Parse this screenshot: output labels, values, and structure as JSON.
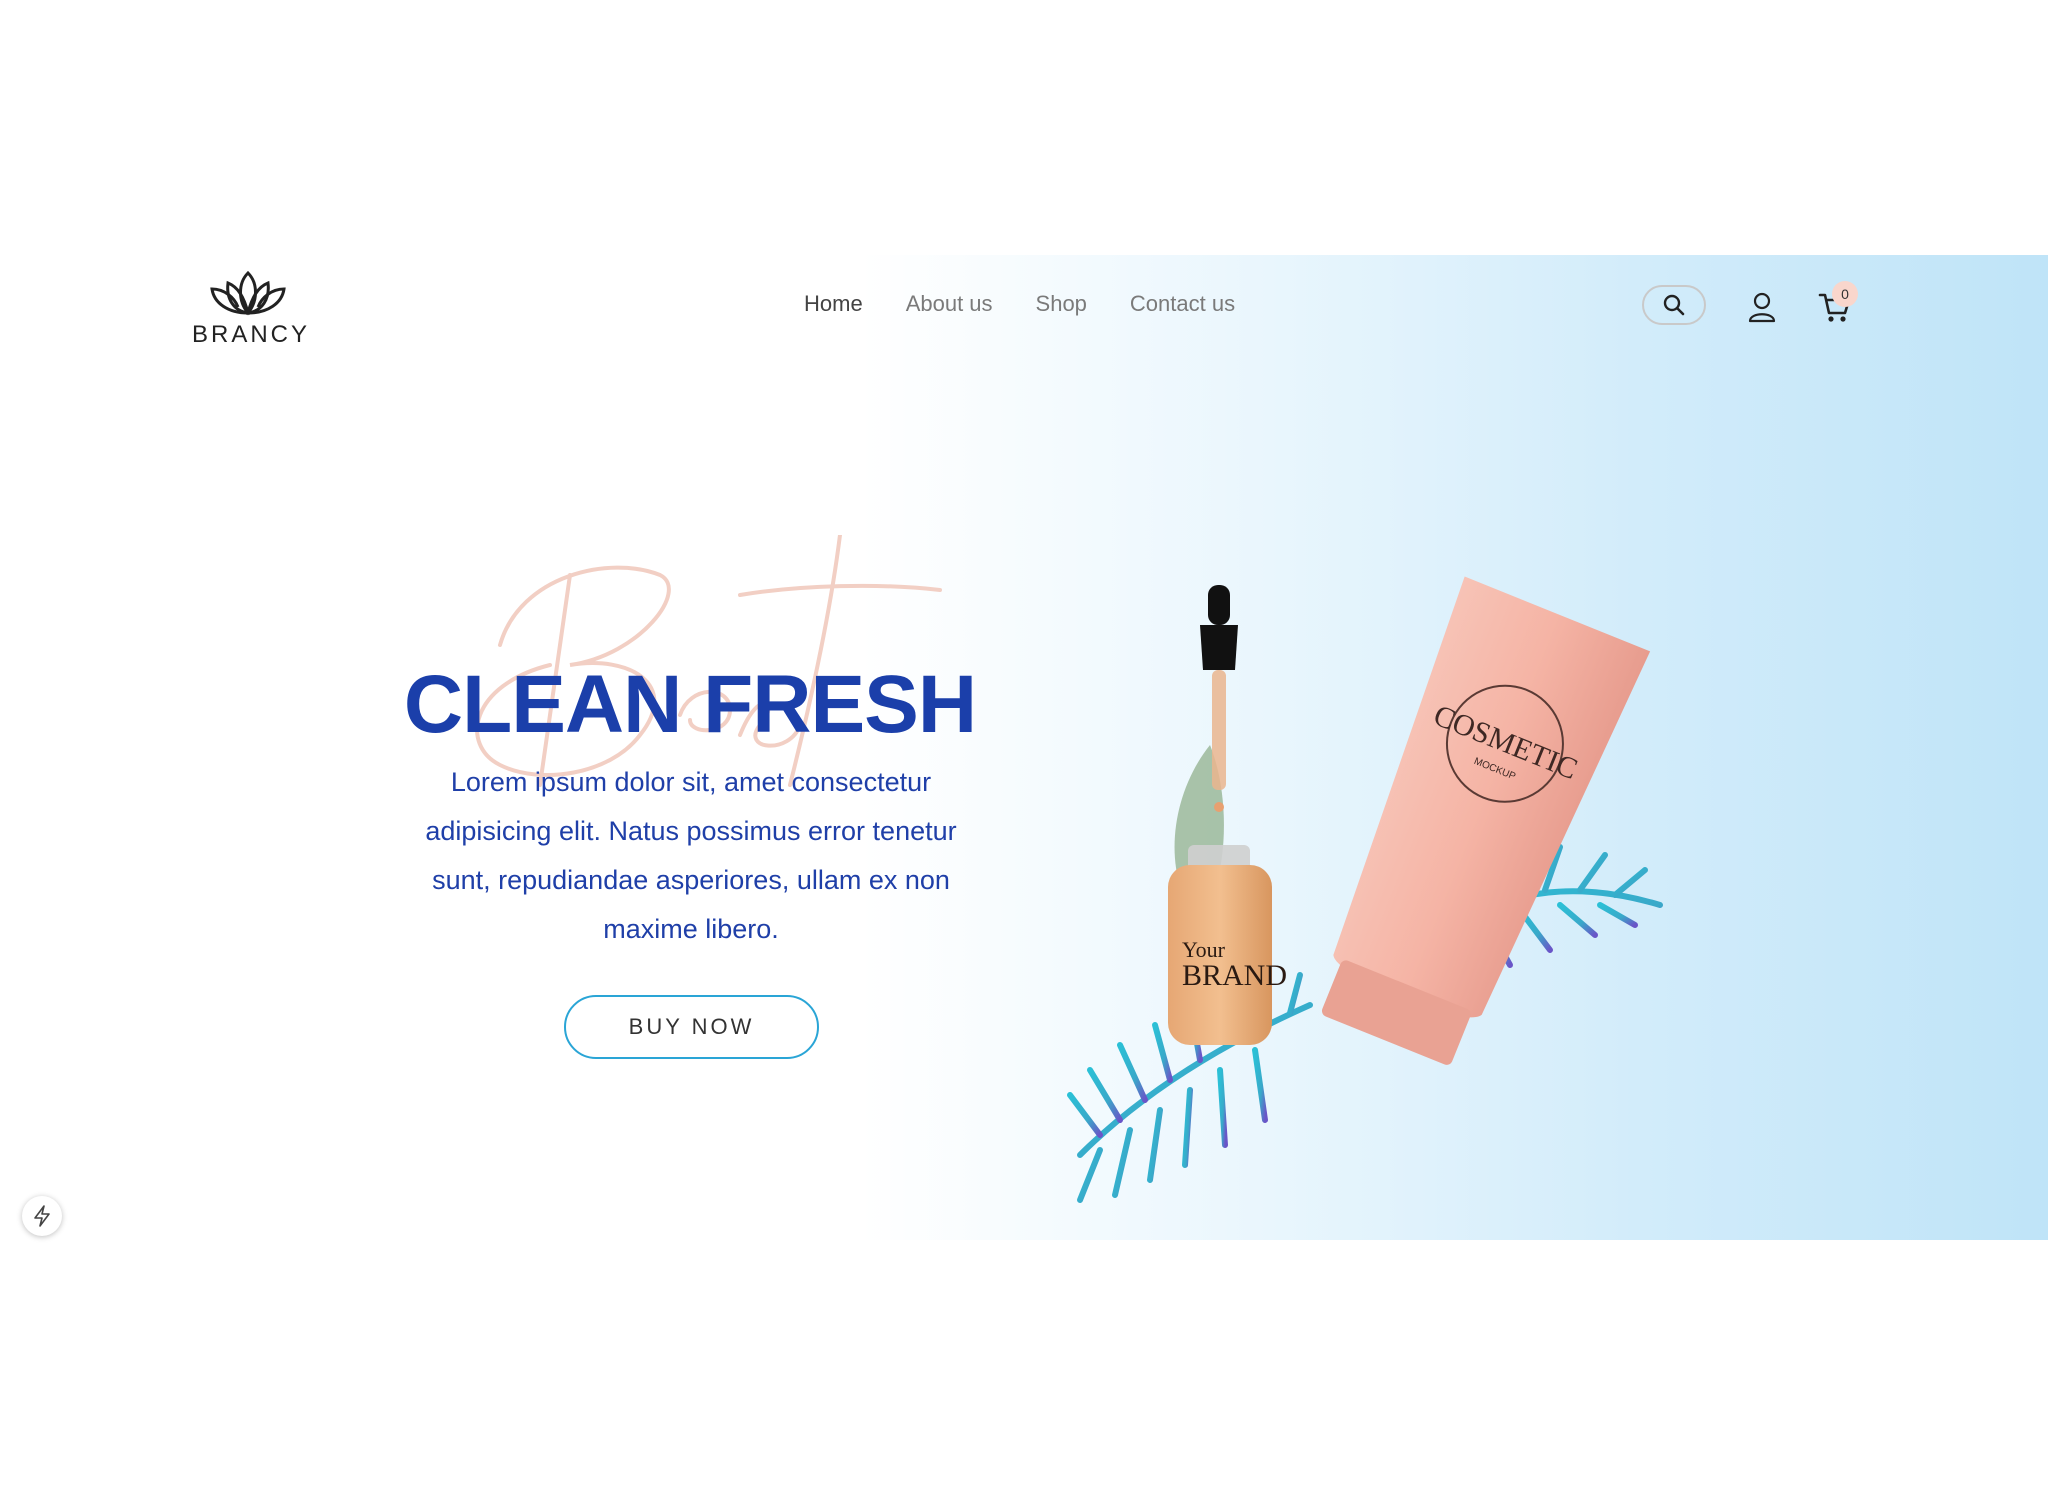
{
  "header": {
    "logo_text": "BRANCY",
    "nav": [
      {
        "label": "Home",
        "active": true
      },
      {
        "label": "About us",
        "active": false
      },
      {
        "label": "Shop",
        "active": false
      },
      {
        "label": "Contact us",
        "active": false
      }
    ],
    "icons": {
      "search": "search-icon",
      "user": "user-icon",
      "cart": "cart-icon"
    },
    "cart_count": "0"
  },
  "hero": {
    "script_word": "Best",
    "title": "CLEAN FRESH",
    "description": "Lorem ipsum dolor sit, amet consectetur adipisicing elit. Natus possimus error tenetur sunt, repudiandae asperiores, ullam ex non maxime libero.",
    "button_label": "BUY NOW",
    "tube_label": "COSMETIC",
    "tube_sublabel": "MOCKUP",
    "bottle_label_top": "Your",
    "bottle_label_main": "BRAND"
  },
  "colors": {
    "title": "#1b3faa",
    "description": "#1f3fa8",
    "button_border": "#2aa5d6",
    "script": "#f2cfc4",
    "gradient_end": "#bfe4f8",
    "badge": "#f9d6cc"
  }
}
